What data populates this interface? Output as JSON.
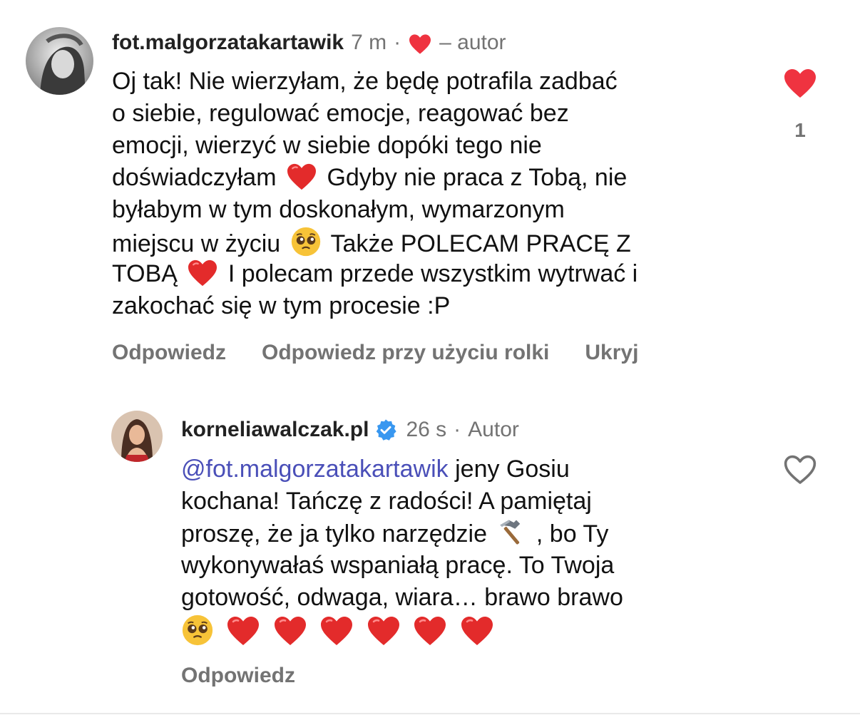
{
  "comment1": {
    "username": "fot.malgorzatakartawik",
    "time": "7 m",
    "separator": "·",
    "author_tag": "– autor",
    "lines": [
      [
        "Oj tak! Nie wierzyłam, że będę potrafila zadbać"
      ],
      [
        "o siebie, regulować emocje, reagować bez"
      ],
      [
        "emocji, wierzyć w siebie dopóki tego nie"
      ],
      [
        "doświadczyłam",
        "Gdyby nie praca z Tobą, nie"
      ],
      [
        "byłabym w tym doskonałym, wymarzonym"
      ],
      [
        "miejscu w życiu",
        "Także POLECAM PRACĘ Z"
      ],
      [
        "TOBĄ",
        "I polecam przede wszystkim wytrwać i"
      ],
      [
        "zakochać się w tym procesie :P"
      ]
    ],
    "actions": {
      "reply": "Odpowiedz",
      "reply_reel": "Odpowiedz przy użyciu rolki",
      "hide": "Ukryj"
    },
    "like_count": "1",
    "liked": true
  },
  "comment2": {
    "username": "korneliawalczak.pl",
    "verified": true,
    "time": "26 s",
    "separator": "·",
    "author_tag": "Autor",
    "mention": "@fot.malgorzatakartawik",
    "lines": [
      [
        "jeny Gosiu"
      ],
      [
        "kochana! Tańczę z radości! A pamiętaj"
      ],
      [
        "proszę, że ja tylko narzędzie",
        ", bo Ty"
      ],
      [
        "wykonywałaś wspaniałą pracę. To Twoja"
      ],
      [
        "gotowość, odwaga, wiara… brawo brawo"
      ]
    ],
    "actions": {
      "reply": "Odpowiedz"
    },
    "liked": false
  },
  "colors": {
    "heart_red": "#ef3340",
    "muted": "#737373",
    "mention": "#4a4fb8",
    "verified_blue": "#3897f0"
  }
}
